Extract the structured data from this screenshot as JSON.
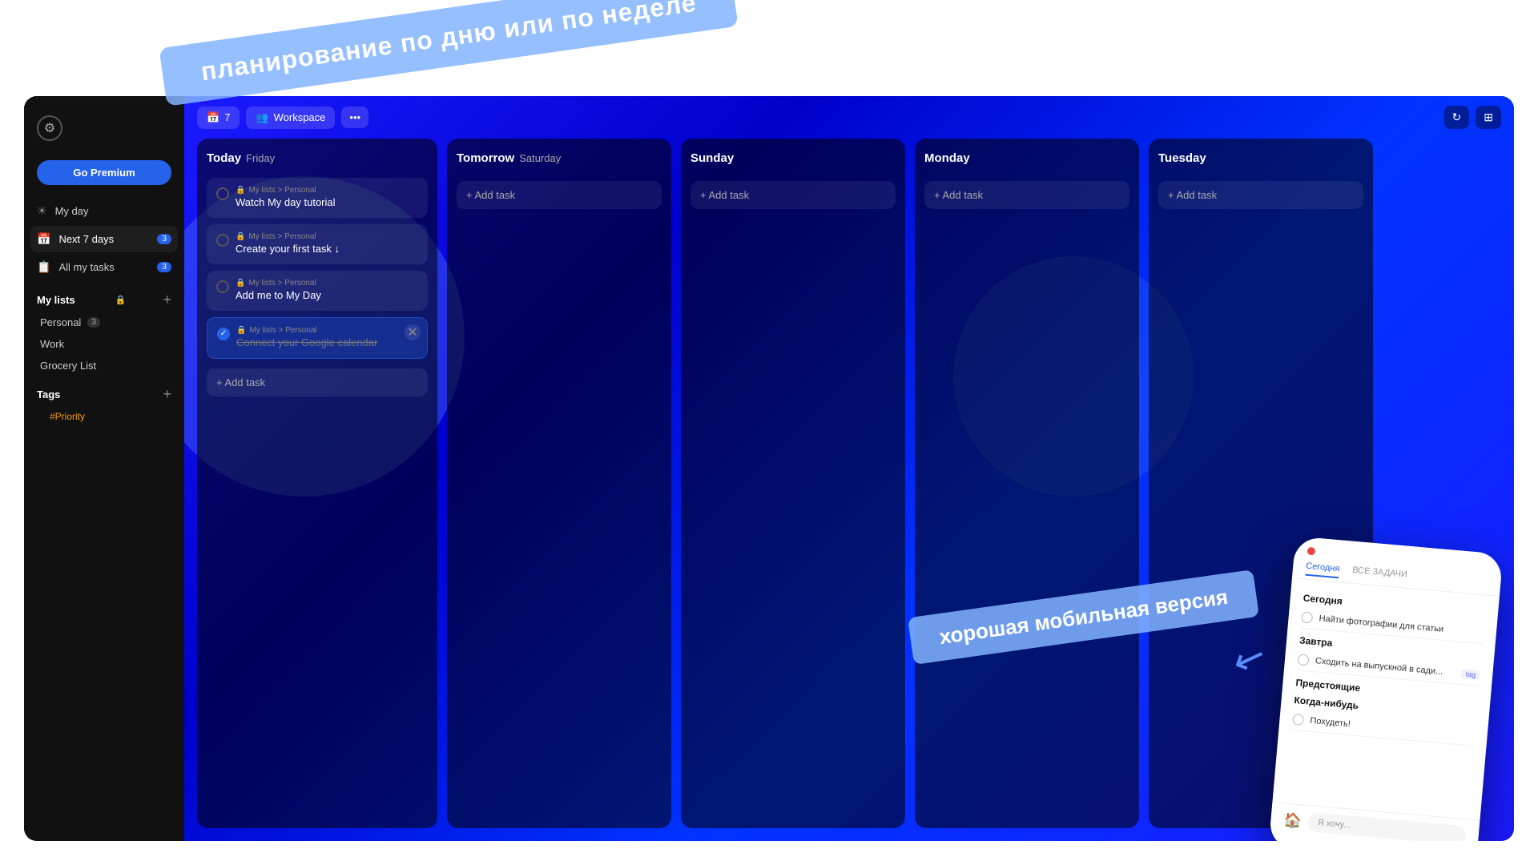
{
  "top_banner": {
    "text": "планирование по дню или по неделе"
  },
  "sidebar": {
    "settings_icon": "⚙",
    "go_premium_label": "Go Premium",
    "nav_items": [
      {
        "id": "my-day",
        "icon": "☀",
        "label": "My day",
        "badge": null
      },
      {
        "id": "next-7-days",
        "icon": "📅",
        "label": "Next 7 days",
        "badge": "3"
      },
      {
        "id": "all-tasks",
        "icon": "📋",
        "label": "All my tasks",
        "badge": "3"
      }
    ],
    "my_lists_label": "My lists",
    "lock_icon": "🔒",
    "lists": [
      {
        "id": "personal",
        "label": "Personal",
        "badge": "3"
      },
      {
        "id": "work",
        "label": "Work",
        "badge": null
      },
      {
        "id": "grocery",
        "label": "Grocery List",
        "badge": null
      }
    ],
    "tags_label": "Tags",
    "tags": [
      {
        "id": "priority",
        "label": "#Priority"
      }
    ]
  },
  "toolbar": {
    "calendar_icon": "📅",
    "calendar_label": "7",
    "workspace_icon": "👥",
    "workspace_label": "Workspace",
    "more_label": "•••",
    "refresh_icon": "↻",
    "layout_icon": "⊞"
  },
  "columns": [
    {
      "id": "today",
      "day": "Today",
      "date": "Friday",
      "tasks": [
        {
          "id": "task1",
          "meta": "My lists > Personal",
          "title": "Watch My day tutorial",
          "completed": false,
          "has_remove": false
        },
        {
          "id": "task2",
          "meta": "My lists > Personal",
          "title": "Create your first task ↓",
          "completed": false,
          "has_remove": false
        },
        {
          "id": "task3",
          "meta": "My lists > Personal",
          "title": "Add me to My Day",
          "completed": false,
          "has_remove": false
        },
        {
          "id": "task4",
          "meta": "My lists > Personal",
          "title": "Connect your Google calendar",
          "completed": true,
          "has_remove": true
        }
      ],
      "add_task_label": "+ Add task"
    },
    {
      "id": "tomorrow",
      "day": "Tomorrow",
      "date": "Saturday",
      "tasks": [],
      "add_task_label": "+ Add task"
    },
    {
      "id": "sunday",
      "day": "Sunday",
      "date": "",
      "tasks": [],
      "add_task_label": "+ Add task"
    },
    {
      "id": "monday",
      "day": "Monday",
      "date": "",
      "tasks": [],
      "add_task_label": "+ Add task"
    },
    {
      "id": "tuesday",
      "day": "Tuesday",
      "date": "",
      "tasks": [],
      "add_task_label": "+ Add task"
    }
  ],
  "mobile": {
    "tab_today": "Сегодня",
    "tab_all": "ВСЕ ЗАДАЧИ",
    "section_today": "Сегодня",
    "section_tomorrow": "Завтра",
    "section_upcoming": "Предстоящие",
    "section_someday": "Когда-нибудь",
    "tasks_today": [
      {
        "title": "Найти фотографии для статьи",
        "tag": null
      }
    ],
    "tasks_tomorrow": [
      {
        "title": "Сходить на выпускной в сади...",
        "tag": "tag"
      }
    ],
    "tasks_someday": [
      {
        "title": "Похудеть!",
        "tag": null
      }
    ],
    "input_placeholder": "Я хочу...",
    "home_icon": "🏠"
  },
  "annotation_mobile": {
    "text": "хорошая мобильная версия"
  }
}
